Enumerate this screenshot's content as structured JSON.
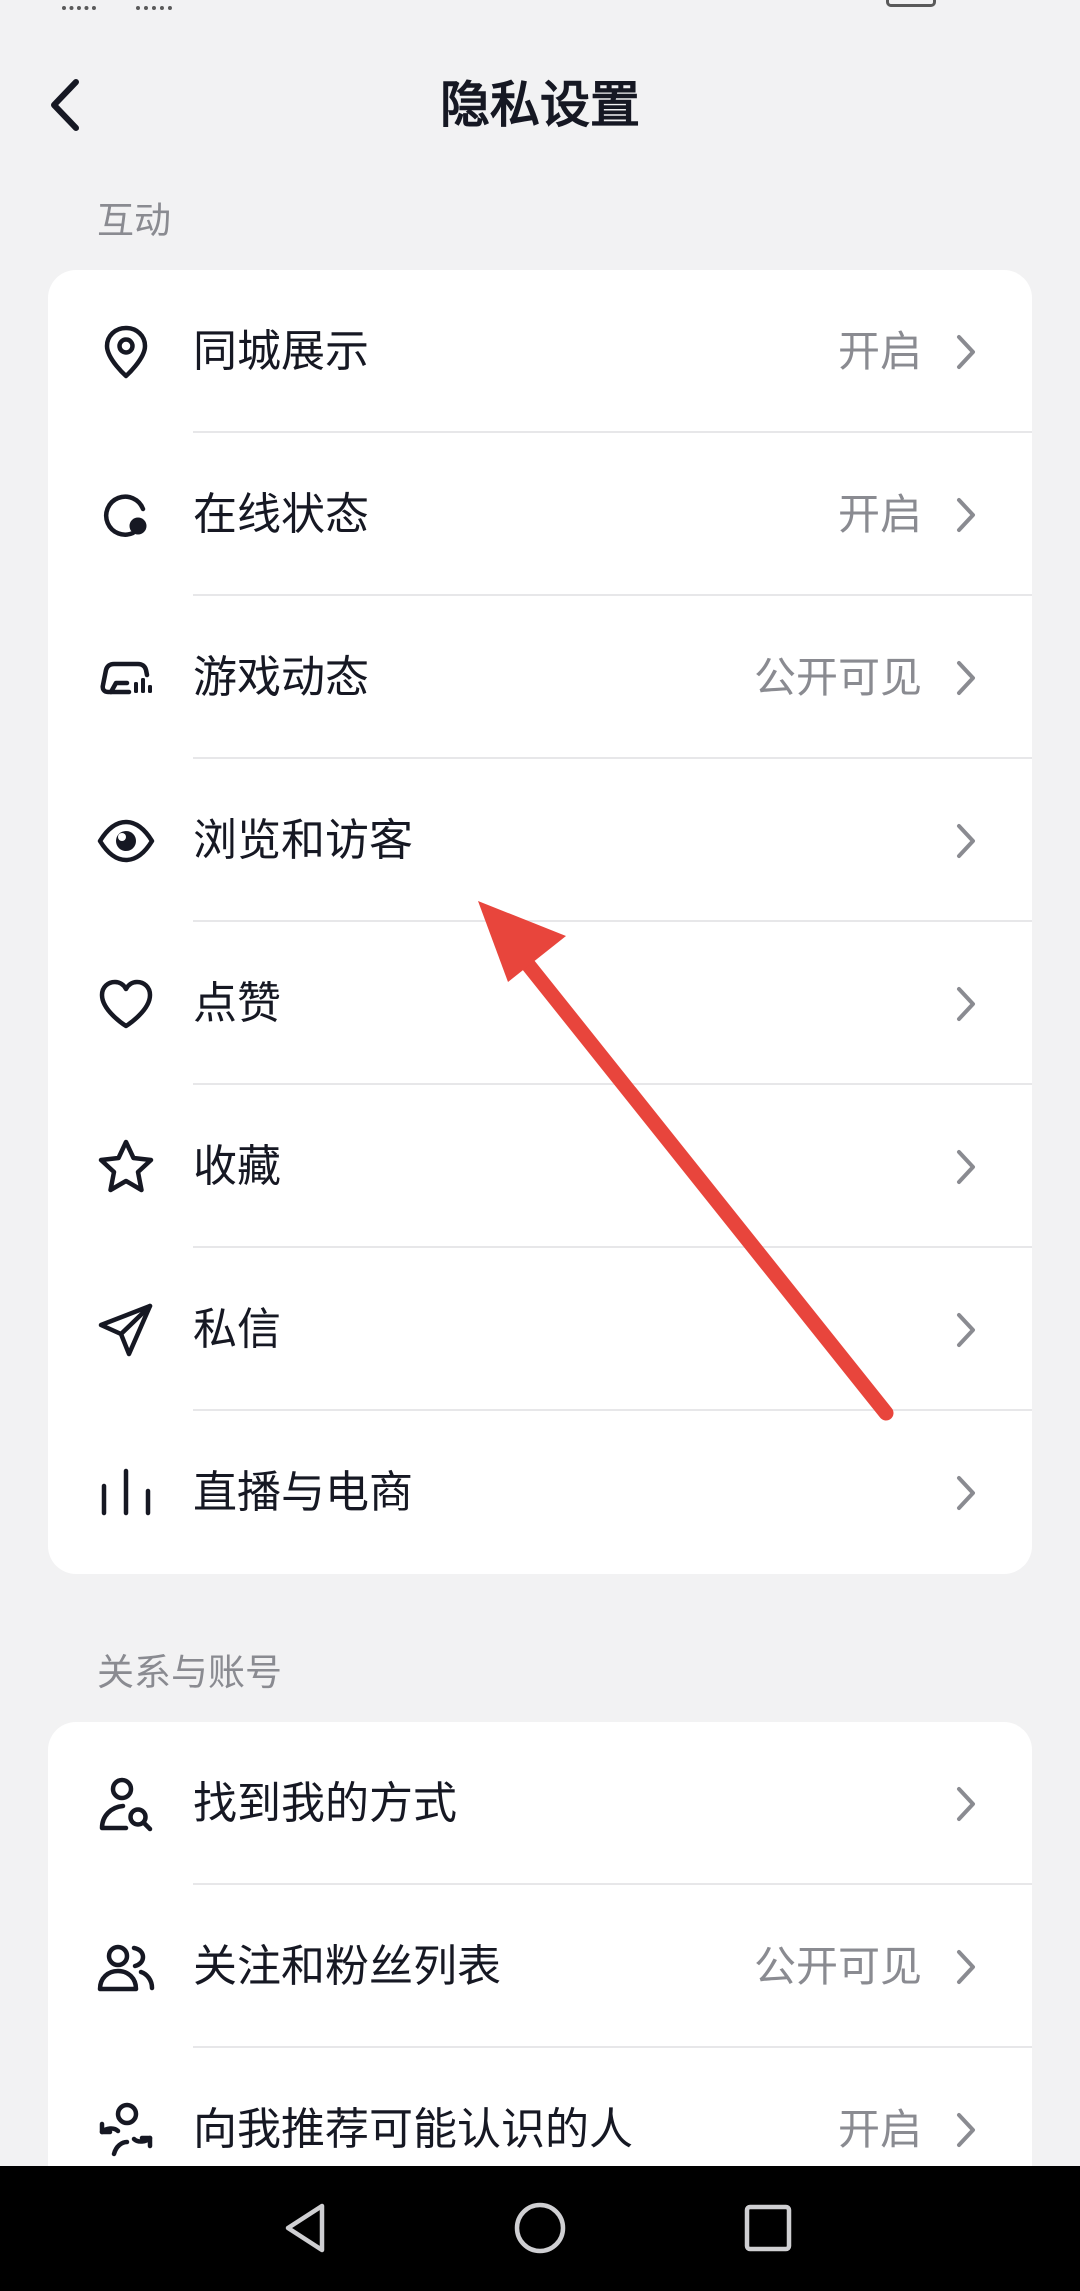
{
  "header": {
    "title": "隐私设置"
  },
  "sections": [
    {
      "label": "互动",
      "items": [
        {
          "icon": "location-pin-icon",
          "label": "同城展示",
          "value": "开启"
        },
        {
          "icon": "online-status-icon",
          "label": "在线状态",
          "value": "开启"
        },
        {
          "icon": "game-controller-icon",
          "label": "游戏动态",
          "value": "公开可见"
        },
        {
          "icon": "eye-icon",
          "label": "浏览和访客",
          "value": ""
        },
        {
          "icon": "heart-icon",
          "label": "点赞",
          "value": ""
        },
        {
          "icon": "star-icon",
          "label": "收藏",
          "value": ""
        },
        {
          "icon": "paper-plane-icon",
          "label": "私信",
          "value": ""
        },
        {
          "icon": "bar-chart-icon",
          "label": "直播与电商",
          "value": ""
        }
      ]
    },
    {
      "label": "关系与账号",
      "items": [
        {
          "icon": "person-search-icon",
          "label": "找到我的方式",
          "value": ""
        },
        {
          "icon": "people-icon",
          "label": "关注和粉丝列表",
          "value": "公开可见"
        },
        {
          "icon": "person-recommend-icon",
          "label": "向我推荐可能认识的人",
          "value": "开启"
        }
      ]
    }
  ],
  "annotation": {
    "type": "arrow",
    "color": "#e8453c"
  },
  "colors": {
    "background": "#f2f2f3",
    "card": "#ffffff",
    "text": "#161823",
    "secondary_text": "#8a8b91",
    "divider": "#e7e7e9"
  }
}
